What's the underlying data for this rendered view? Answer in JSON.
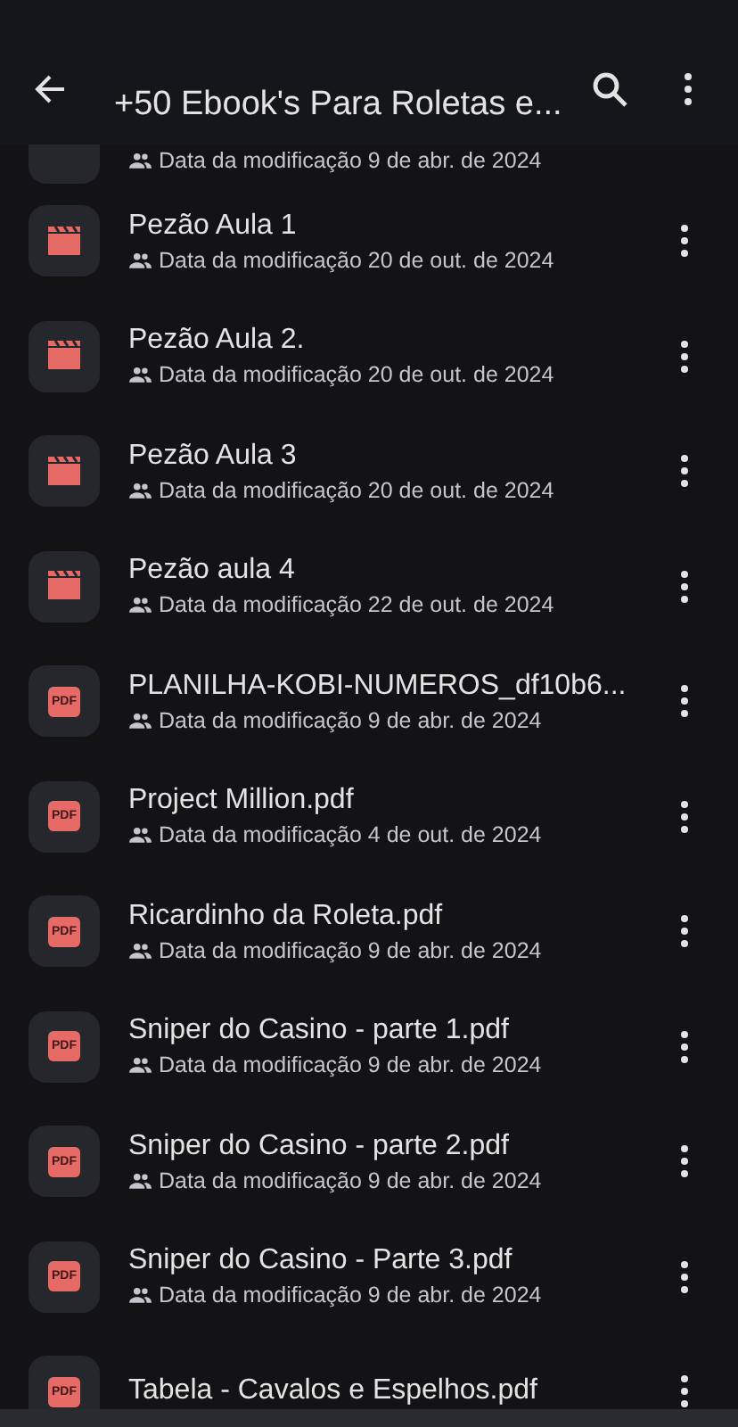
{
  "toolbar": {
    "title": "+50 Ebook's Para Roletas e..."
  },
  "partial_row": {
    "modified": "Data da modificação 9 de abr. de 2024"
  },
  "files": [
    {
      "kind": "video",
      "name": "Pezão Aula 1",
      "modified": "Data da modificação 20 de out. de 2024"
    },
    {
      "kind": "video",
      "name": "Pezão Aula 2.",
      "modified": "Data da modificação 20 de out. de 2024"
    },
    {
      "kind": "video",
      "name": "Pezão Aula 3",
      "modified": "Data da modificação 20 de out. de 2024"
    },
    {
      "kind": "video",
      "name": "Pezão aula 4",
      "modified": "Data da modificação 22 de out. de 2024"
    },
    {
      "kind": "pdf",
      "icon_label": "PDF",
      "name": "PLANILHA-KOBI-NUMEROS_df10b6...",
      "modified": "Data da modificação 9 de abr. de 2024"
    },
    {
      "kind": "pdf",
      "icon_label": "PDF",
      "name": "Project Million.pdf",
      "modified": "Data da modificação 4 de out. de 2024"
    },
    {
      "kind": "pdf",
      "icon_label": "PDF",
      "name": "Ricardinho da Roleta.pdf",
      "modified": "Data da modificação 9 de abr. de 2024"
    },
    {
      "kind": "pdf",
      "icon_label": "PDF",
      "name": "Sniper do Casino - parte 1.pdf",
      "modified": "Data da modificação 9 de abr. de 2024"
    },
    {
      "kind": "pdf",
      "icon_label": "PDF",
      "name": "Sniper do Casino - parte 2.pdf",
      "modified": "Data da modificação 9 de abr. de 2024"
    },
    {
      "kind": "pdf",
      "icon_label": "PDF",
      "name": "Sniper do Casino - Parte 3.pdf",
      "modified": "Data da modificação 9 de abr. de 2024"
    },
    {
      "kind": "pdf",
      "icon_label": "PDF",
      "name": "Tabela - Cavalos e Espelhos.pdf"
    }
  ]
}
